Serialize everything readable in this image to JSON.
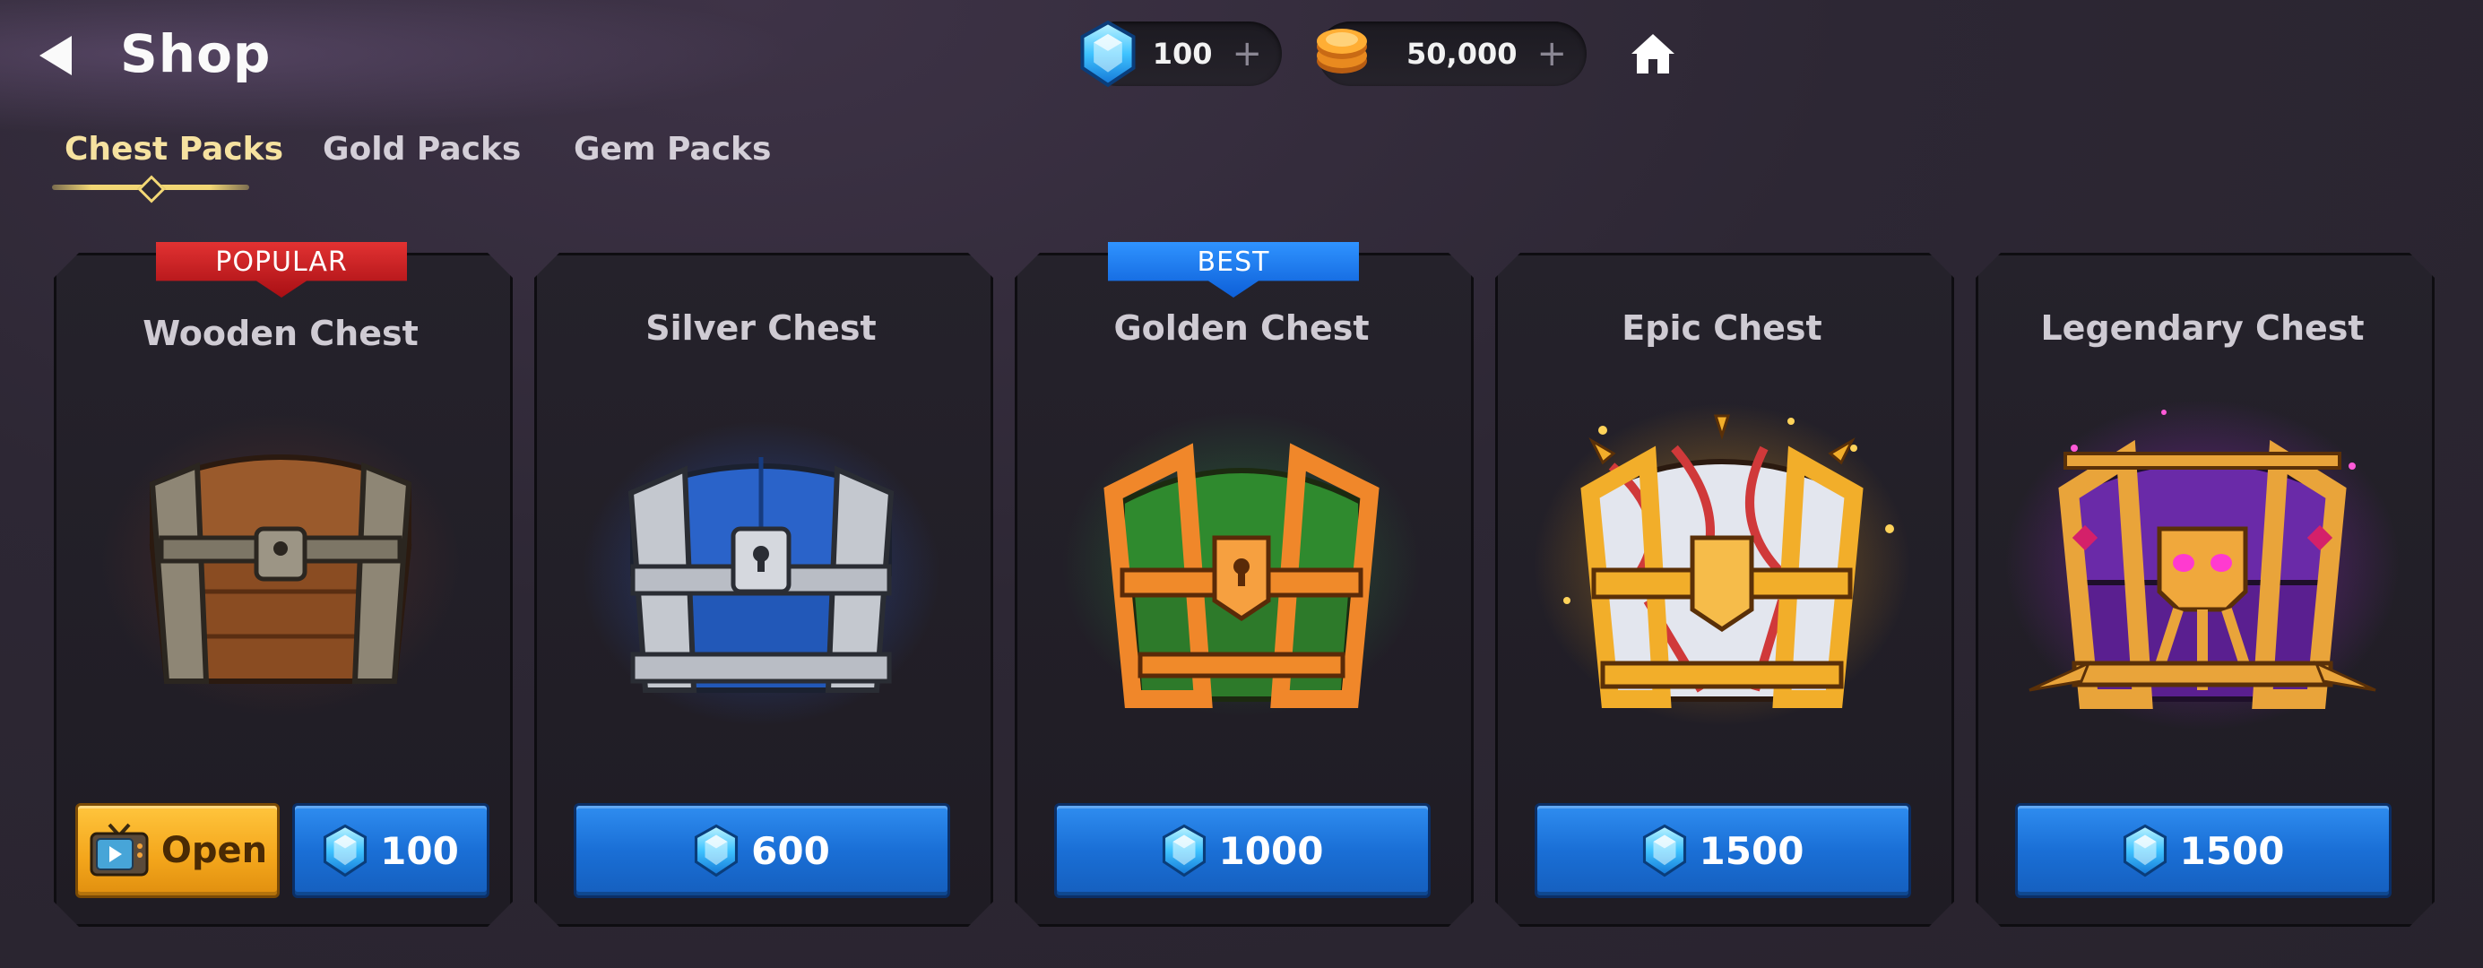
{
  "header": {
    "title": "Shop",
    "gems": {
      "value": "100",
      "plus": "+"
    },
    "gold": {
      "value": "50,000",
      "plus": "+"
    }
  },
  "tabs": [
    {
      "label": "Chest Packs",
      "active": true
    },
    {
      "label": "Gold Packs",
      "active": false
    },
    {
      "label": "Gem Packs",
      "active": false
    }
  ],
  "cards": [
    {
      "title": "Wooden Chest",
      "badge": "POPULAR",
      "badge_color": "#c8161c",
      "open_label": "Open",
      "price": "100"
    },
    {
      "title": "Silver Chest",
      "badge": "",
      "price": "600"
    },
    {
      "title": "Golden Chest",
      "badge": "BEST",
      "badge_color": "#1877e8",
      "price": "1000"
    },
    {
      "title": "Epic Chest",
      "badge": "",
      "price": "1500"
    },
    {
      "title": "Legendary Chest",
      "badge": "",
      "price": "1500"
    }
  ],
  "colors": {
    "accent_gold": "#f2d775",
    "button_blue": "#1a6fd6",
    "button_yellow": "#f3a51b",
    "background": "#2d2734"
  },
  "icons": [
    "back-arrow-icon",
    "gem-icon",
    "gold-coin-icon",
    "home-icon",
    "tv-ad-icon"
  ]
}
